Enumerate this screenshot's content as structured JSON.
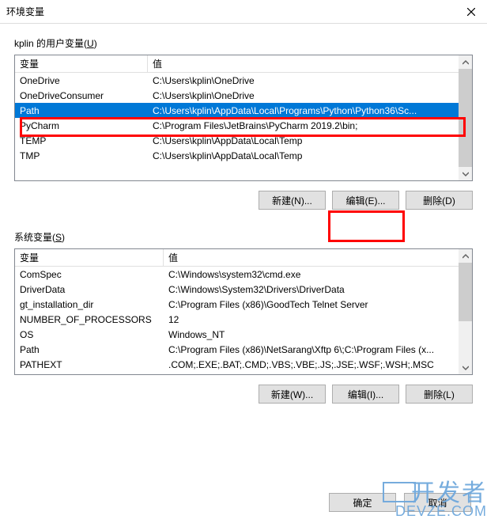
{
  "window": {
    "title": "环境变量"
  },
  "user_vars": {
    "label_prefix": "kplin 的用户变量(",
    "label_hotkey": "U",
    "label_suffix": ")",
    "header_var": "变量",
    "header_val": "值",
    "rows": [
      {
        "name": "OneDrive",
        "value": "C:\\Users\\kplin\\OneDrive",
        "selected": false
      },
      {
        "name": "OneDriveConsumer",
        "value": "C:\\Users\\kplin\\OneDrive",
        "selected": false
      },
      {
        "name": "Path",
        "value": "C:\\Users\\kplin\\AppData\\Local\\Programs\\Python\\Python36\\Sc...",
        "selected": true
      },
      {
        "name": "PyCharm",
        "value": "C:\\Program Files\\JetBrains\\PyCharm 2019.2\\bin;",
        "selected": false
      },
      {
        "name": "TEMP",
        "value": "C:\\Users\\kplin\\AppData\\Local\\Temp",
        "selected": false
      },
      {
        "name": "TMP",
        "value": "C:\\Users\\kplin\\AppData\\Local\\Temp",
        "selected": false
      }
    ],
    "btn_new": "新建(N)...",
    "btn_edit": "编辑(E)...",
    "btn_delete": "删除(D)"
  },
  "system_vars": {
    "label_prefix": "系统变量(",
    "label_hotkey": "S",
    "label_suffix": ")",
    "header_var": "变量",
    "header_val": "值",
    "rows": [
      {
        "name": "ComSpec",
        "value": "C:\\Windows\\system32\\cmd.exe"
      },
      {
        "name": "DriverData",
        "value": "C:\\Windows\\System32\\Drivers\\DriverData"
      },
      {
        "name": "gt_installation_dir",
        "value": "C:\\Program Files (x86)\\GoodTech Telnet Server"
      },
      {
        "name": "NUMBER_OF_PROCESSORS",
        "value": "12"
      },
      {
        "name": "OS",
        "value": "Windows_NT"
      },
      {
        "name": "Path",
        "value": "C:\\Program Files (x86)\\NetSarang\\Xftp 6\\;C:\\Program Files (x..."
      },
      {
        "name": "PATHEXT",
        "value": ".COM;.EXE;.BAT;.CMD;.VBS;.VBE;.JS;.JSE;.WSF;.WSH;.MSC"
      }
    ],
    "btn_new": "新建(W)...",
    "btn_edit": "编辑(I)...",
    "btn_delete": "删除(L)"
  },
  "dialog": {
    "ok": "确定",
    "cancel": "取消"
  },
  "watermark": "开发者",
  "watermark2": "DEVZE.COM"
}
